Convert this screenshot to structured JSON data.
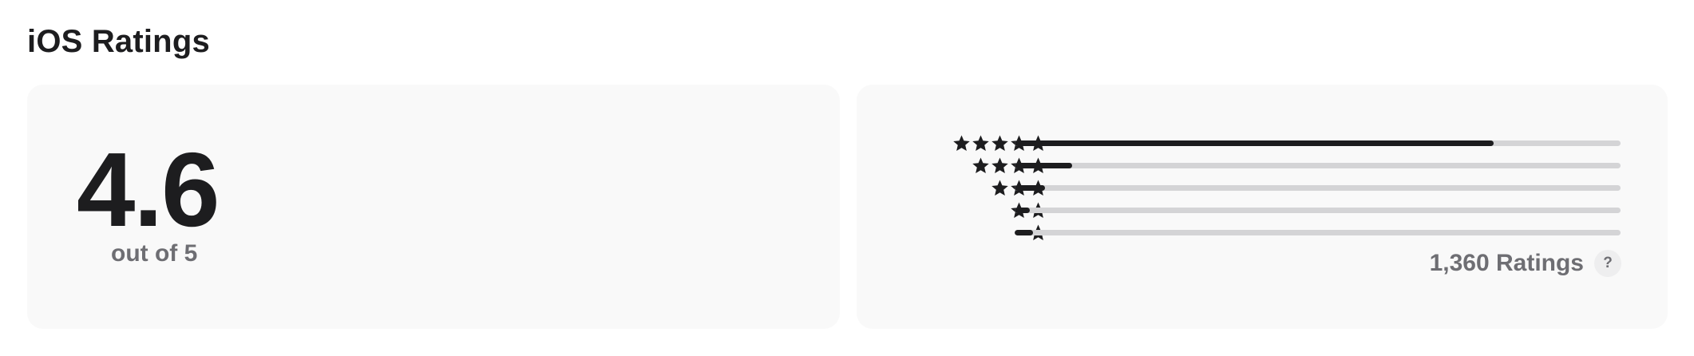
{
  "section": {
    "title": "iOS Ratings"
  },
  "score": {
    "value": "4.6",
    "caption": "out of 5"
  },
  "breakdown": {
    "rows": [
      {
        "stars": 5,
        "fraction": 0.79
      },
      {
        "stars": 4,
        "fraction": 0.095
      },
      {
        "stars": 3,
        "fraction": 0.05
      },
      {
        "stars": 2,
        "fraction": 0.025
      },
      {
        "stars": 1,
        "fraction": 0.03
      }
    ],
    "ratings_count": "1,360 Ratings",
    "help_label": "?"
  },
  "icons": {
    "star": "star-icon",
    "help": "question-mark-icon"
  },
  "colors": {
    "text": "#1d1d1f",
    "secondary_text": "#6e6e73",
    "card_background": "#f9f9f9",
    "bar_fill": "#1d1d1f",
    "bar_track": "#d4d4d6"
  }
}
